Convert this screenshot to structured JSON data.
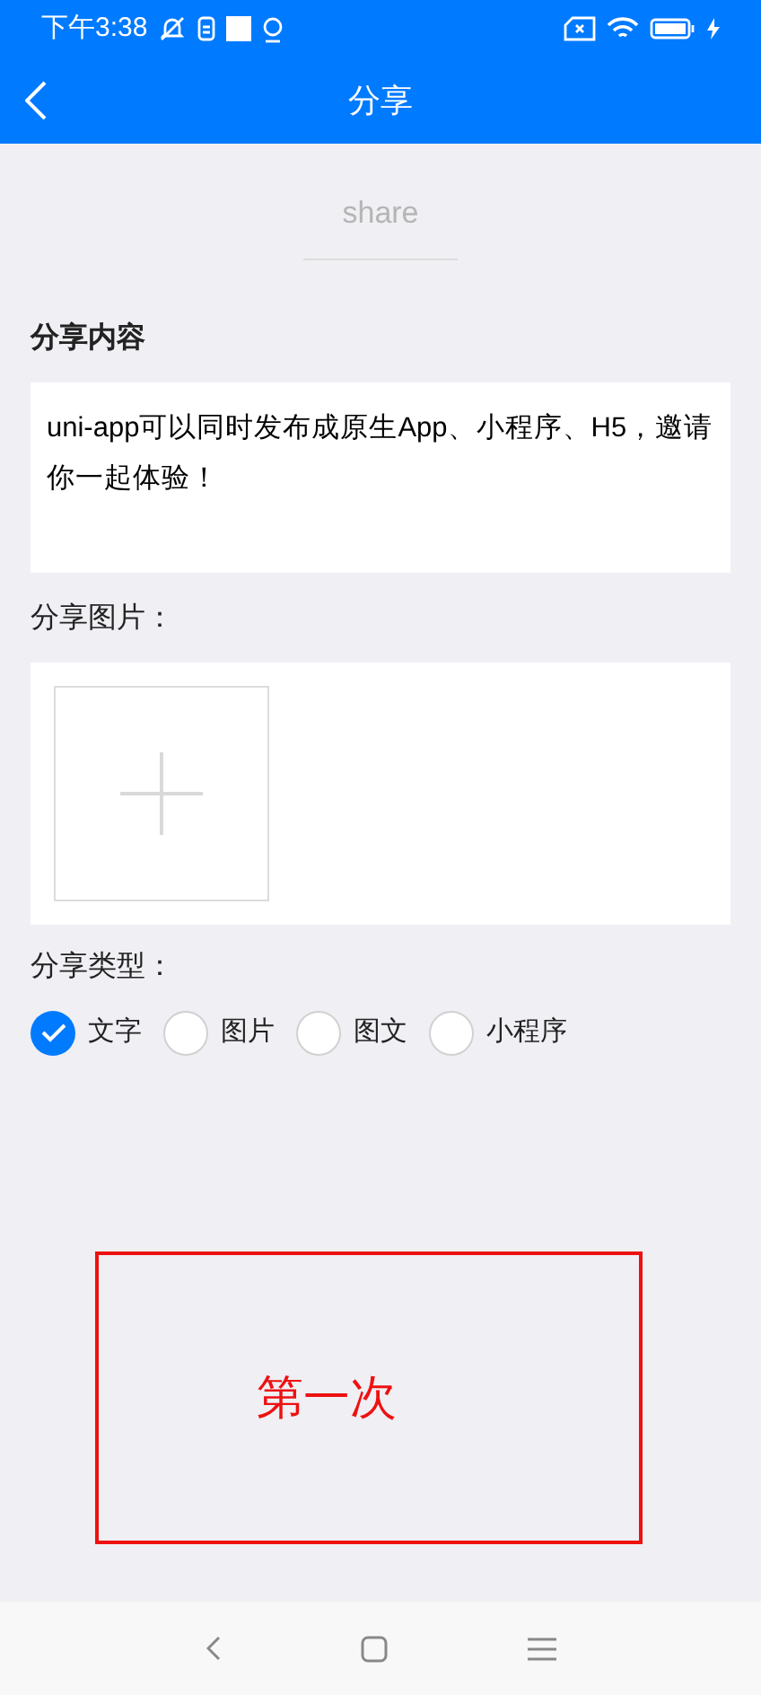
{
  "status_bar": {
    "time": "下午3:38"
  },
  "nav_bar": {
    "title": "分享"
  },
  "share_heading": "share",
  "content": {
    "label": "分享内容",
    "value": "uni-app可以同时发布成原生App、小程序、H5，邀请你一起体验！"
  },
  "image": {
    "label": "分享图片："
  },
  "share_type": {
    "label": "分享类型：",
    "options": [
      {
        "label": "文字",
        "selected": true
      },
      {
        "label": "图片",
        "selected": false
      },
      {
        "label": "图文",
        "selected": false
      },
      {
        "label": "小程序",
        "selected": false
      }
    ]
  },
  "annotation": {
    "text": "第一次",
    "color": "#ee1111"
  }
}
